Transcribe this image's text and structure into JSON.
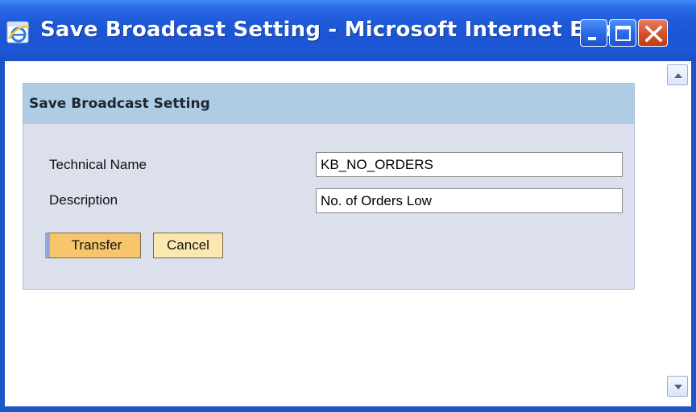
{
  "window": {
    "title": "Save Broadcast Setting - Microsoft Internet Expl...",
    "icon": "internet-explorer-icon",
    "controls": {
      "minimize": "minimize-icon",
      "maximize": "maximize-icon",
      "close": "close-icon"
    }
  },
  "panel": {
    "title": "Save Broadcast Setting",
    "fields": [
      {
        "label": "Technical Name",
        "value": "KB_NO_ORDERS"
      },
      {
        "label": "Description",
        "value": "No. of Orders Low"
      }
    ],
    "buttons": {
      "transfer": "Transfer",
      "cancel": "Cancel"
    }
  },
  "scrollbar": {
    "up_icon": "scroll-up-arrow-icon",
    "down_icon": "scroll-down-arrow-icon"
  },
  "colors": {
    "titlebar": "#1f5ad8",
    "panel_header": "#b0cbe4",
    "panel_body": "#dcdfec",
    "primary_button": "#f7c66a",
    "secondary_button": "#fbe8b0"
  }
}
